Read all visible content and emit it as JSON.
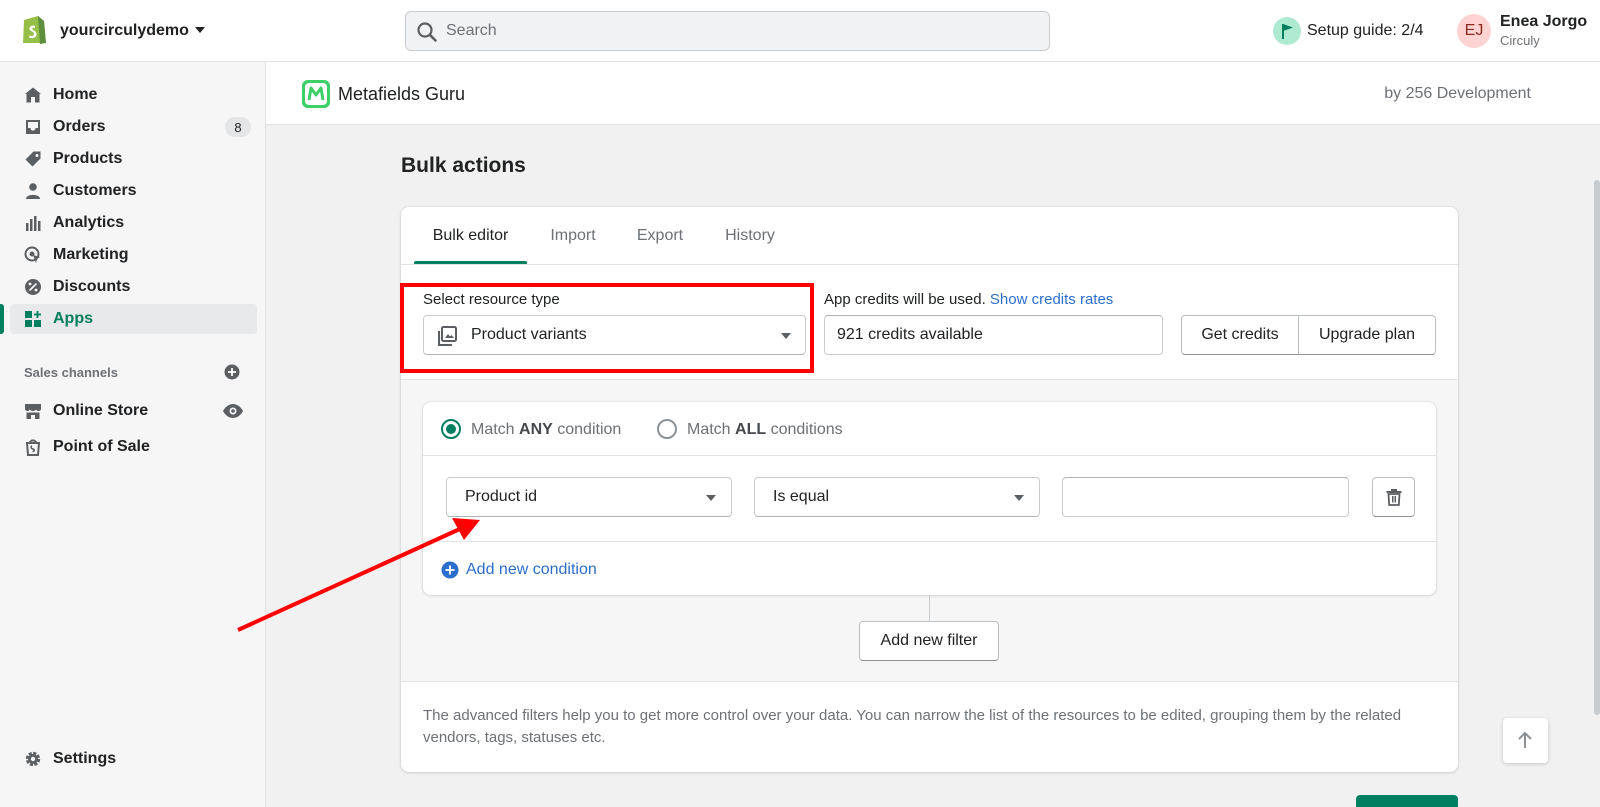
{
  "topbar": {
    "store_name": "yourcirculydemo",
    "search_placeholder": "Search",
    "setup_guide": "Setup guide: 2/4",
    "user_initials": "EJ",
    "user_name": "Enea Jorgo",
    "user_org": "Circuly"
  },
  "sidebar": {
    "items": [
      {
        "label": "Home",
        "icon": "home-icon"
      },
      {
        "label": "Orders",
        "icon": "inbox-icon",
        "badge": "8"
      },
      {
        "label": "Products",
        "icon": "tag-icon"
      },
      {
        "label": "Customers",
        "icon": "person-icon"
      },
      {
        "label": "Analytics",
        "icon": "bar-chart-icon"
      },
      {
        "label": "Marketing",
        "icon": "target-icon"
      },
      {
        "label": "Discounts",
        "icon": "discount-icon"
      },
      {
        "label": "Apps",
        "icon": "apps-icon",
        "active": true
      }
    ],
    "sales_channels_title": "Sales channels",
    "channels": [
      {
        "label": "Online Store",
        "icon": "store-icon"
      },
      {
        "label": "Point of Sale",
        "icon": "bag-icon"
      }
    ],
    "settings_label": "Settings"
  },
  "app_header": {
    "app_name": "Metafields Guru",
    "by": "by 256 Development"
  },
  "page": {
    "title": "Bulk actions",
    "tabs": [
      {
        "label": "Bulk editor",
        "active": true
      },
      {
        "label": "Import"
      },
      {
        "label": "Export"
      },
      {
        "label": "History"
      }
    ],
    "resource": {
      "label": "Select resource type",
      "value": "Product variants"
    },
    "credits": {
      "notice": "App credits will be used.",
      "link": "Show credits rates",
      "available": "921 credits available",
      "get_credits": "Get credits",
      "upgrade": "Upgrade plan"
    },
    "filter": {
      "match_any_prefix": "Match ",
      "match_any_bold": "ANY",
      "match_any_suffix": " condition",
      "match_all_prefix": "Match ",
      "match_all_bold": "ALL",
      "match_all_suffix": " conditions",
      "selected": "any",
      "field": "Product id",
      "operator": "Is equal",
      "value": "",
      "add_condition": "Add new condition",
      "add_filter": "Add new filter"
    },
    "help_text": "The advanced filters help you to get more control over your data. You can narrow the list of the resources to be edited, grouping them by the related vendors, tags, statuses etc."
  },
  "colors": {
    "accent": "#008060",
    "link": "#2c6ecb",
    "annotation": "#ff0000"
  }
}
